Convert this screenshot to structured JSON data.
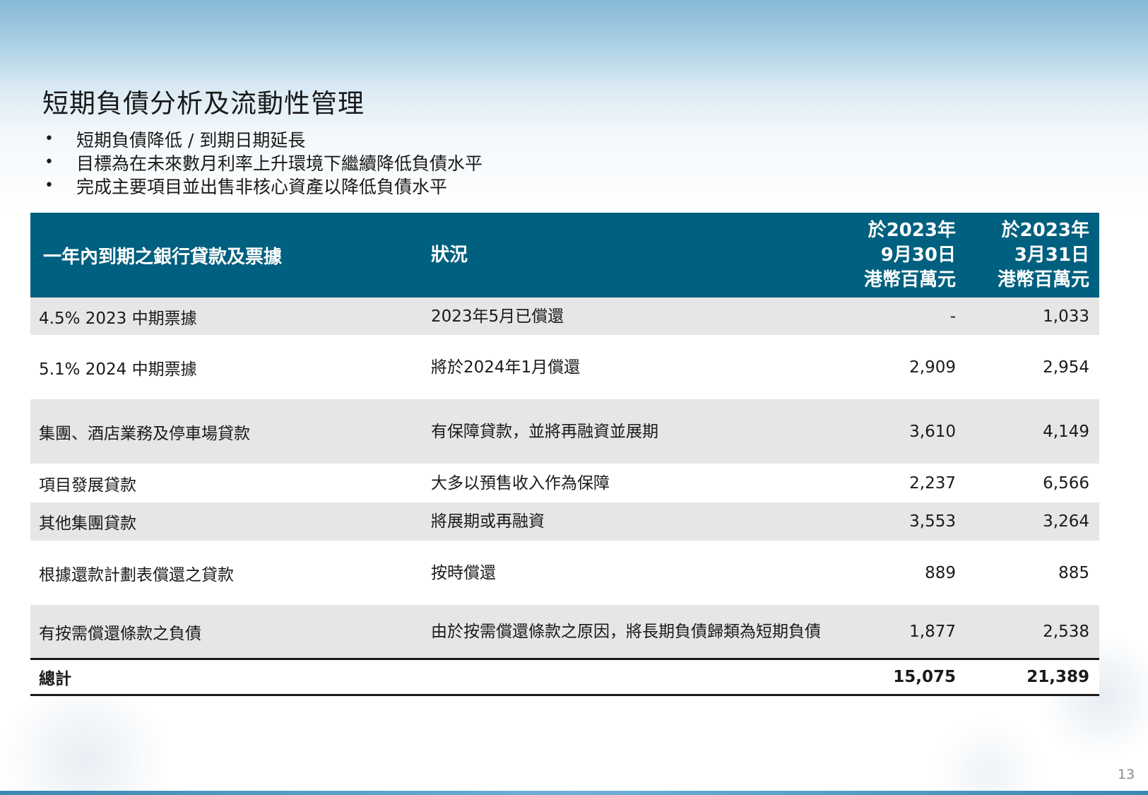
{
  "title": "短期負債分析及流動性管理",
  "bullets": [
    {
      "marker": "•",
      "text": "短期負債降低 / 到期日期延長"
    },
    {
      "marker": "•",
      "text": "目標為在未來數月利率上升環境下繼續降低負債水平"
    },
    {
      "marker": "•",
      "text": "完成主要項目並出售非核心資產以降低負債水平"
    }
  ],
  "table": {
    "headers": {
      "item": "一年內到期之銀行貸款及票據",
      "status": "狀況",
      "col_sep": {
        "line1": "於2023年",
        "line2": "9月30日",
        "line3": "港幣百萬元"
      },
      "col_mar": {
        "line1": "於2023年",
        "line2": "3月31日",
        "line3": "港幣百萬元"
      }
    },
    "rows": [
      {
        "item": "4.5% 2023 中期票據",
        "status": "2023年5月已償還",
        "sep": "-",
        "mar": "1,033"
      },
      {
        "item": "5.1% 2024 中期票據",
        "status": "將於2024年1月償還",
        "sep": "2,909",
        "mar": "2,954"
      },
      {
        "item": "集團、酒店業務及停車場貸款",
        "status": "有保障貸款，並將再融資並展期",
        "sep": "3,610",
        "mar": "4,149"
      },
      {
        "item": "項目發展貸款",
        "status": "大多以預售收入作為保障",
        "sep": "2,237",
        "mar": "6,566"
      },
      {
        "item": "其他集團貸款",
        "status": "將展期或再融資",
        "sep": "3,553",
        "mar": "3,264"
      },
      {
        "item": "根據還款計劃表償還之貸款",
        "status": "按時償還",
        "sep": "889",
        "mar": "885"
      },
      {
        "item": "有按需償還條款之負債",
        "status": "由於按需償還條款之原因，將長期負債歸類為短期負債",
        "sep": "1,877",
        "mar": "2,538"
      }
    ],
    "total": {
      "item": "總計",
      "sep": "15,075",
      "mar": "21,389"
    }
  },
  "page_number": "13"
}
